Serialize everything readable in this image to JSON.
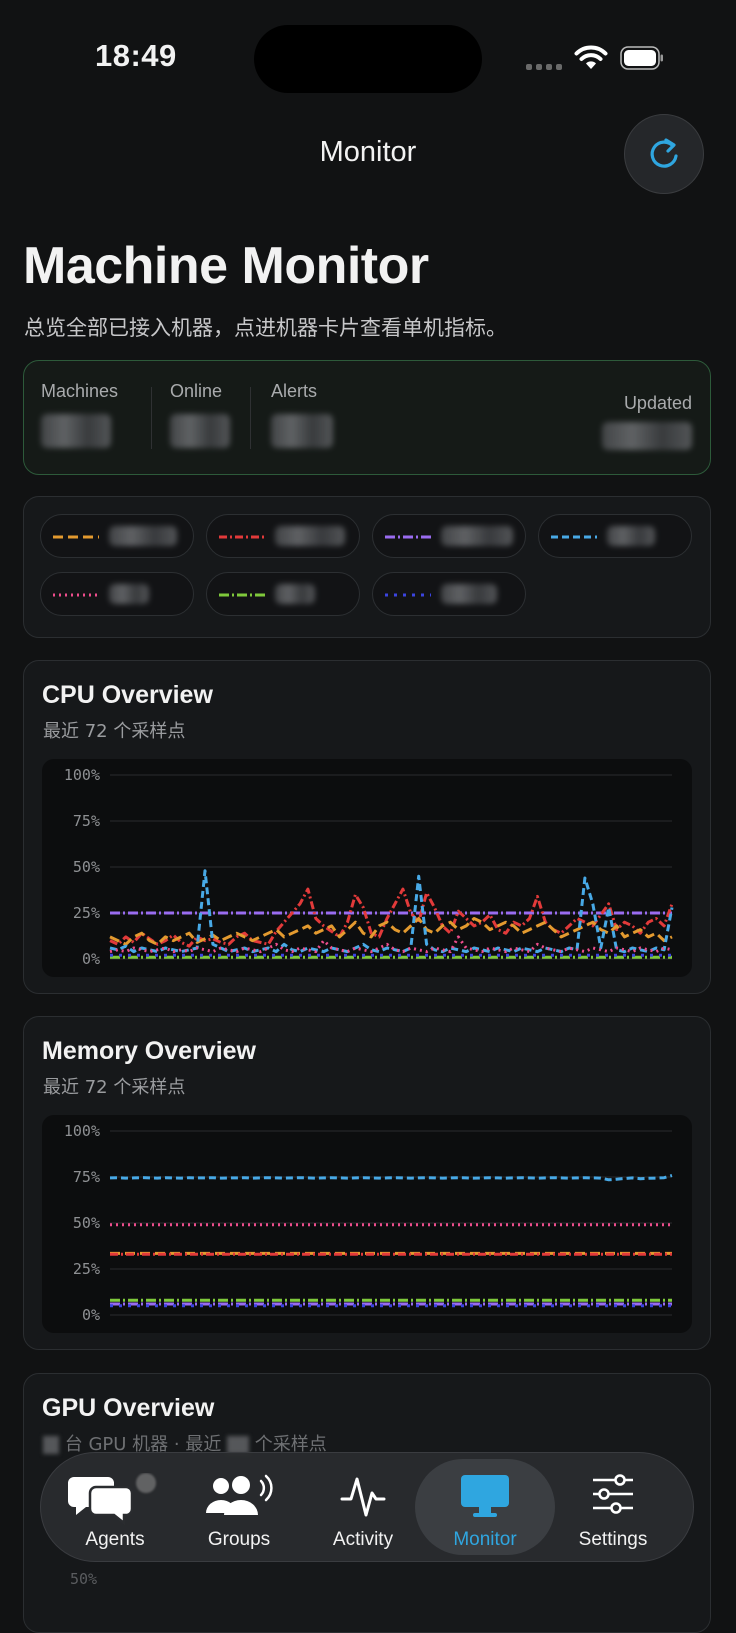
{
  "status_bar": {
    "time": "18:49"
  },
  "nav": {
    "title": "Monitor",
    "refresh_icon": "refresh-icon"
  },
  "header": {
    "title": "Machine Monitor",
    "subtitle": "总览全部已接入机器，点进机器卡片查看单机指标。"
  },
  "summary": {
    "machines_label": "Machines",
    "online_label": "Online",
    "alerts_label": "Alerts",
    "updated_label": "Updated"
  },
  "legend": {
    "items": [
      {
        "color": "#e39a2f",
        "dash": "10 5"
      },
      {
        "color": "#e23a3a",
        "dash": "8 3 2 3"
      },
      {
        "color": "#9a6cf0",
        "dash": "10 3 2 3"
      },
      {
        "color": "#48a9e6",
        "dash": "7 4"
      },
      {
        "color": "#ee4d8c",
        "dash": "2 4"
      },
      {
        "color": "#7fc93b",
        "dash": "10 3 2 3"
      },
      {
        "color": "#3b44e0",
        "dash": "3 6"
      }
    ]
  },
  "cpu": {
    "title": "CPU Overview",
    "subtitle": "最近 72 个采样点",
    "y_ticks": [
      "100%",
      "75%",
      "50%",
      "25%",
      "0%"
    ]
  },
  "memory": {
    "title": "Memory Overview",
    "subtitle": "最近 72 个采样点",
    "y_ticks": [
      "100%",
      "75%",
      "50%",
      "25%",
      "0%"
    ]
  },
  "gpu": {
    "title": "GPU Overview",
    "subtitle_parts": [
      "台 GPU 机器 · 最近",
      "个采样点"
    ],
    "visible_tick": "50%"
  },
  "tabs": [
    {
      "label": "Agents",
      "icon": "chat-bubbles-icon"
    },
    {
      "label": "Groups",
      "icon": "people-icon"
    },
    {
      "label": "Activity",
      "icon": "pulse-icon"
    },
    {
      "label": "Monitor",
      "icon": "monitor-icon",
      "active": true
    },
    {
      "label": "Settings",
      "icon": "sliders-icon"
    }
  ],
  "chart_data": [
    {
      "type": "line",
      "title": "CPU Overview",
      "ylim": [
        0,
        100
      ],
      "y_unit": "%",
      "x": "samples 1–72",
      "series": [
        {
          "color": "#9a6cf0",
          "values": [
            25,
            25,
            25,
            25,
            25,
            25,
            25,
            25,
            25,
            25,
            25,
            25,
            25,
            25,
            25,
            25,
            25,
            25,
            25,
            25,
            25,
            25,
            25,
            25,
            25,
            25,
            25,
            25,
            25,
            25,
            25,
            25,
            25,
            25,
            25,
            25,
            25,
            25,
            25,
            25,
            25,
            25,
            25,
            25,
            25,
            25,
            25,
            25,
            25,
            25,
            25,
            25,
            25,
            25,
            25,
            25,
            25,
            25,
            25,
            25,
            25,
            25,
            25,
            25,
            25,
            25,
            25,
            25,
            25,
            25,
            25,
            25
          ]
        },
        {
          "color": "#e23a3a",
          "values": [
            10,
            8,
            12,
            9,
            14,
            11,
            8,
            10,
            13,
            9,
            7,
            12,
            10,
            11,
            9,
            8,
            12,
            14,
            10,
            9,
            8,
            15,
            20,
            25,
            30,
            38,
            22,
            18,
            15,
            12,
            20,
            35,
            28,
            14,
            12,
            22,
            30,
            38,
            25,
            20,
            36,
            28,
            18,
            14,
            26,
            22,
            18,
            20,
            24,
            16,
            14,
            20,
            18,
            22,
            34,
            20,
            16,
            14,
            18,
            22,
            20,
            18,
            24,
            30,
            16,
            20,
            18,
            14,
            20,
            22,
            18,
            30
          ]
        },
        {
          "color": "#e39a2f",
          "values": [
            12,
            10,
            8,
            12,
            14,
            10,
            8,
            12,
            10,
            12,
            14,
            9,
            11,
            13,
            10,
            12,
            14,
            12,
            10,
            12,
            14,
            16,
            12,
            14,
            16,
            18,
            14,
            16,
            18,
            12,
            16,
            20,
            14,
            12,
            18,
            20,
            16,
            14,
            18,
            22,
            16,
            14,
            18,
            20,
            16,
            18,
            22,
            20,
            16,
            18,
            20,
            18,
            14,
            16,
            18,
            20,
            16,
            12,
            14,
            16,
            18,
            20,
            16,
            14,
            18,
            12,
            14,
            16,
            12,
            14,
            10,
            12
          ]
        },
        {
          "color": "#48a9e6",
          "values": [
            6,
            5,
            7,
            4,
            6,
            5,
            4,
            6,
            5,
            4,
            5,
            6,
            48,
            8,
            6,
            4,
            5,
            6,
            4,
            5,
            6,
            4,
            8,
            5,
            4,
            6,
            5,
            4,
            6,
            5,
            4,
            6,
            8,
            5,
            4,
            6,
            5,
            4,
            6,
            45,
            8,
            5,
            4,
            6,
            5,
            4,
            6,
            5,
            4,
            6,
            5,
            4,
            6,
            5,
            4,
            6,
            5,
            4,
            6,
            5,
            44,
            30,
            6,
            28,
            5,
            4,
            6,
            5,
            4,
            6,
            5,
            28
          ]
        },
        {
          "color": "#ee4d8c",
          "values": [
            4,
            5,
            4,
            6,
            5,
            4,
            5,
            6,
            4,
            5,
            4,
            6,
            5,
            4,
            6,
            5,
            4,
            6,
            5,
            4,
            6,
            8,
            5,
            4,
            6,
            5,
            4,
            10,
            6,
            5,
            4,
            6,
            5,
            4,
            6,
            8,
            5,
            4,
            6,
            5,
            4,
            6,
            5,
            4,
            12,
            6,
            5,
            4,
            6,
            5,
            4,
            6,
            5,
            4,
            8,
            6,
            5,
            4,
            6,
            5,
            4,
            6,
            5,
            4,
            6,
            5,
            4,
            6,
            5,
            4,
            6,
            5
          ]
        },
        {
          "color": "#7fc93b",
          "values": [
            1,
            1,
            1,
            1,
            1,
            1,
            1,
            1,
            1,
            1,
            1,
            1,
            1,
            1,
            1,
            1,
            1,
            1,
            1,
            1,
            1,
            1,
            1,
            1,
            1,
            1,
            1,
            1,
            1,
            1,
            1,
            1,
            1,
            1,
            1,
            1,
            1,
            1,
            1,
            1,
            1,
            1,
            1,
            1,
            1,
            1,
            1,
            1,
            1,
            1,
            1,
            1,
            1,
            1,
            1,
            1,
            1,
            1,
            1,
            1,
            1,
            1,
            1,
            1,
            1,
            1,
            1,
            1,
            1,
            1,
            1,
            1
          ]
        },
        {
          "color": "#3b44e0",
          "values": [
            2,
            2,
            2,
            2,
            2,
            2,
            2,
            2,
            2,
            2,
            2,
            2,
            2,
            2,
            2,
            2,
            2,
            2,
            2,
            2,
            2,
            2,
            2,
            2,
            2,
            2,
            2,
            2,
            2,
            2,
            2,
            2,
            2,
            2,
            2,
            2,
            2,
            2,
            2,
            2,
            2,
            2,
            2,
            2,
            2,
            2,
            2,
            2,
            2,
            2,
            2,
            2,
            2,
            2,
            2,
            2,
            2,
            2,
            2,
            2,
            2,
            2,
            2,
            2,
            2,
            2,
            2,
            2,
            2,
            2,
            2,
            2
          ]
        }
      ]
    },
    {
      "type": "line",
      "title": "Memory Overview",
      "ylim": [
        0,
        100
      ],
      "y_unit": "%",
      "x": "samples 1–72",
      "series": [
        {
          "color": "#48a9e6",
          "values": [
            74.5,
            74.6,
            74.4,
            74.5,
            74.7,
            74.5,
            74.4,
            74.6,
            74.5,
            74.4,
            74.6,
            74.5,
            74.5,
            74.6,
            74.4,
            74.5,
            74.5,
            74.6,
            74.4,
            74.5,
            74.6,
            74.5,
            74.4,
            74.5,
            74.6,
            74.5,
            74.4,
            74.5,
            74.6,
            74.5,
            74.4,
            74.5,
            74.6,
            74.5,
            74.4,
            74.5,
            74.6,
            74.5,
            74.4,
            74.5,
            74.6,
            74.5,
            74.4,
            74.5,
            74.6,
            74.5,
            74.4,
            74.5,
            74.6,
            74.5,
            74.4,
            74.5,
            74.6,
            74.5,
            74.4,
            74.5,
            74.6,
            74.5,
            74.4,
            74.5,
            74.6,
            74.5,
            74.4,
            73.5,
            73.8,
            74.2,
            74.5,
            74.1,
            74.3,
            74.4,
            74.6,
            75.8
          ]
        },
        {
          "color": "#ee4d8c",
          "values": [
            49,
            49,
            49,
            49,
            49,
            49,
            49,
            49,
            49,
            49,
            49,
            49,
            49,
            49,
            49,
            49,
            49,
            49,
            49,
            49,
            49,
            49,
            49,
            49,
            49,
            49,
            49,
            49,
            49,
            49,
            49,
            49,
            49,
            49,
            49,
            49,
            49,
            49,
            49,
            49,
            49,
            49,
            49,
            49,
            49,
            49,
            49,
            49,
            49,
            49,
            49,
            49,
            49,
            49,
            49,
            49,
            49,
            49,
            49,
            49,
            49,
            49,
            49,
            49,
            49,
            49,
            49,
            49,
            49,
            49,
            49,
            49
          ]
        },
        {
          "color": "#e39a2f",
          "values": [
            33.5,
            33.5,
            33.5,
            33.5,
            33.5,
            33.5,
            33.5,
            33.5,
            33.5,
            33.5,
            33.5,
            33.5,
            33.5,
            33.5,
            33.5,
            33.5,
            33.5,
            33.5,
            33.5,
            33.5,
            33.5,
            33.5,
            33.5,
            33.5,
            33.5,
            33.5,
            33.5,
            33.5,
            33.5,
            33.5,
            33.5,
            33.5,
            33.5,
            33.5,
            33.5,
            33.5,
            33.5,
            33.5,
            33.5,
            33.5,
            33.5,
            33.5,
            33.5,
            33.5,
            33.5,
            33.5,
            33.5,
            33.5,
            33.5,
            33.5,
            33.5,
            33.5,
            33.5,
            33.5,
            33.5,
            33.5,
            33.5,
            33.5,
            33.5,
            33.5,
            33.5,
            33.5,
            33.5,
            33.5,
            33.5,
            33.5,
            33.5,
            33.5,
            33.5,
            33.5,
            33.5,
            33.5
          ]
        },
        {
          "color": "#e23a3a",
          "values": [
            33,
            33,
            33,
            33,
            33,
            33,
            33,
            33,
            33,
            33,
            33,
            33,
            33,
            33,
            33,
            33,
            33,
            33,
            33,
            33,
            33,
            33,
            33,
            33,
            33,
            33,
            33,
            33,
            33,
            33,
            33,
            33,
            33,
            33,
            33,
            33,
            33,
            33,
            33,
            33,
            33,
            33,
            33,
            33,
            33,
            33,
            33,
            33,
            33,
            33,
            33,
            33,
            33,
            33,
            33,
            33,
            33,
            33,
            33,
            33,
            33,
            33,
            33,
            33,
            33,
            33,
            33,
            33,
            33,
            33,
            33,
            33
          ]
        },
        {
          "color": "#7fc93b",
          "values": [
            8,
            8,
            8,
            8,
            8,
            8,
            8,
            8,
            8,
            8,
            8,
            8,
            8,
            8,
            8,
            8,
            8,
            8,
            8,
            8,
            8,
            8,
            8,
            8,
            8,
            8,
            8,
            8,
            8,
            8,
            8,
            8,
            8,
            8,
            8,
            8,
            8,
            8,
            8,
            8,
            8,
            8,
            8,
            8,
            8,
            8,
            8,
            8,
            8,
            8,
            8,
            8,
            8,
            8,
            8,
            8,
            8,
            8,
            8,
            8,
            8,
            8,
            8,
            8,
            8,
            8,
            8,
            8,
            8,
            8,
            8,
            8
          ]
        },
        {
          "color": "#9a6cf0",
          "values": [
            6,
            6,
            6,
            6,
            6,
            6,
            6,
            6,
            6,
            6,
            6,
            6,
            6,
            6,
            6,
            6,
            6,
            6,
            6,
            6,
            6,
            6,
            6,
            6,
            6,
            6,
            6,
            6,
            6,
            6,
            6,
            6,
            6,
            6,
            6,
            6,
            6,
            6,
            6,
            6,
            6,
            6,
            6,
            6,
            6,
            6,
            6,
            6,
            6,
            6,
            6,
            6,
            6,
            6,
            6,
            6,
            6,
            6,
            6,
            6,
            6,
            6,
            6,
            6,
            6,
            6,
            6,
            6,
            6,
            6,
            6,
            6
          ]
        },
        {
          "color": "#3b44e0",
          "values": [
            5,
            5,
            5,
            5,
            5,
            5,
            5,
            5,
            5,
            5,
            5,
            5,
            5,
            5,
            5,
            5,
            5,
            5,
            5,
            5,
            5,
            5,
            5,
            5,
            5,
            5,
            5,
            5,
            5,
            5,
            5,
            5,
            5,
            5,
            5,
            5,
            5,
            5,
            5,
            5,
            5,
            5,
            5,
            5,
            5,
            5,
            5,
            5,
            5,
            5,
            5,
            5,
            5,
            5,
            5,
            5,
            5,
            5,
            5,
            5,
            5,
            5,
            5,
            5,
            5,
            5,
            5,
            5,
            5,
            5,
            5,
            5
          ]
        }
      ]
    }
  ]
}
